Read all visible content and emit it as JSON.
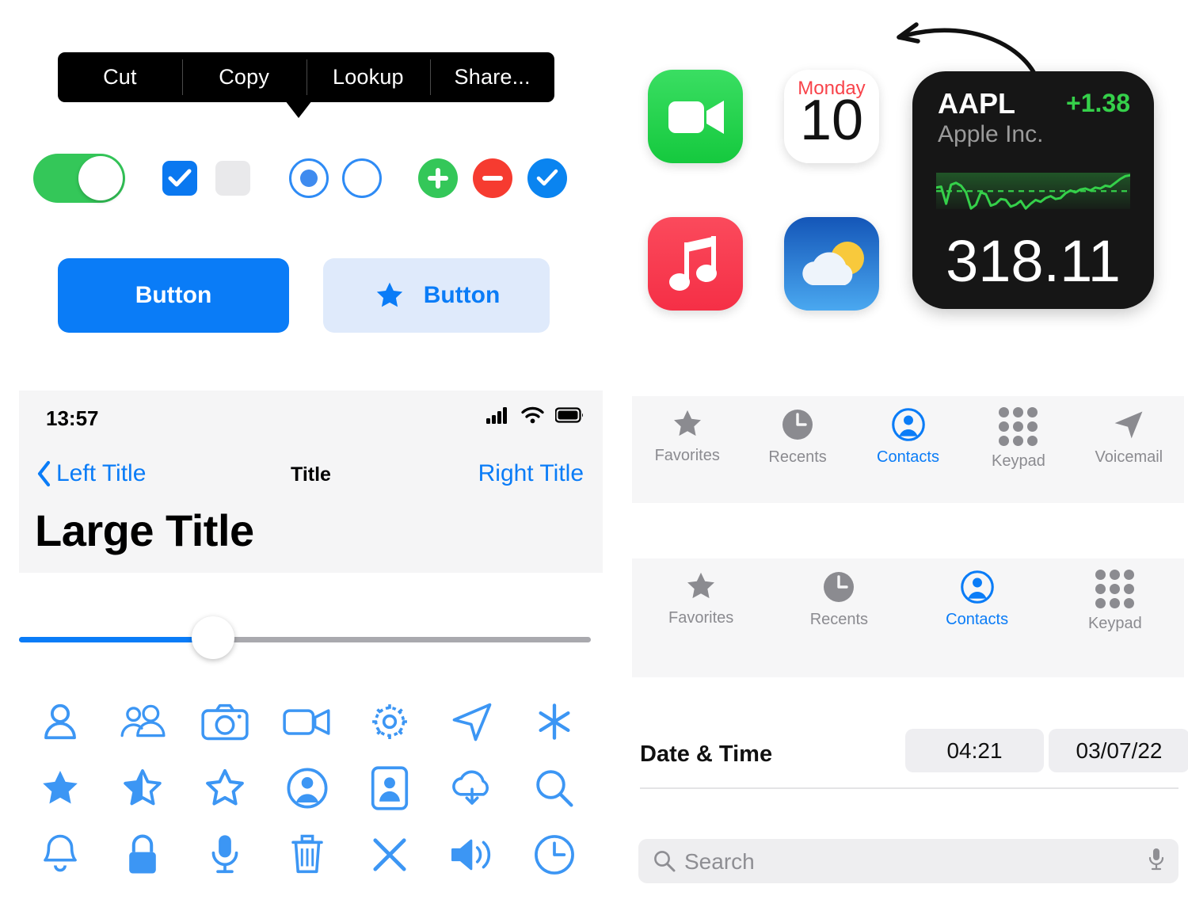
{
  "edit_menu": {
    "items": [
      {
        "label": "Cut",
        "name": "menu-item-cut"
      },
      {
        "label": "Copy",
        "name": "menu-item-copy"
      },
      {
        "label": "Lookup",
        "name": "menu-item-lookup"
      },
      {
        "label": "Share...",
        "name": "menu-item-share"
      }
    ]
  },
  "controls": {
    "toggle": {
      "state": "on",
      "color": "#34c759"
    },
    "checkbox_checked": {
      "state": "checked",
      "color": "#0a78f0"
    },
    "checkbox_unchecked": {
      "state": "unchecked",
      "color": "#e9e9eb"
    },
    "radio_selected": {
      "state": "selected",
      "color": "#2e8bf5"
    },
    "radio_unselected": {
      "state": "unselected",
      "color": "#2e8bf5"
    },
    "add_button": {
      "color": "#34c759"
    },
    "remove_button": {
      "color": "#f63b30"
    },
    "confirm_button": {
      "color": "#0a84f0"
    }
  },
  "buttons": {
    "filled": {
      "label": "Button",
      "bg": "#0a7cf7",
      "fg": "#ffffff"
    },
    "tinted": {
      "label": "Button",
      "bg": "#dfeafb",
      "fg": "#0a7cf7"
    }
  },
  "nav_panel": {
    "status_bar": {
      "time": "13:57"
    },
    "left_title": "Left Title",
    "title": "Title",
    "right_title": "Right Title",
    "large_title": "Large Title",
    "accent": "#0a7cf7"
  },
  "slider": {
    "value_percent": 34,
    "fill_color": "#0a7cf7",
    "track_color": "#a9a9ae"
  },
  "icon_grid": {
    "tint": "#3c96f4",
    "rows": [
      [
        "person-icon",
        "two-people-icon",
        "camera-icon",
        "video-camera-icon",
        "gear-icon",
        "paperplane-icon",
        "asterisk-icon"
      ],
      [
        "star-fill-icon",
        "star-half-icon",
        "star-outline-icon",
        "person-circle-fill-icon",
        "contact-card-icon",
        "cloud-download-icon",
        "magnifier-icon"
      ],
      [
        "bell-icon",
        "lock-icon",
        "microphone-icon",
        "trash-icon",
        "xmark-icon",
        "speaker-wave-icon",
        "clock-icon"
      ]
    ]
  },
  "app_icons": {
    "facetime": {
      "name": "facetime-app-icon"
    },
    "calendar": {
      "name": "calendar-app-icon",
      "weekday": "Monday",
      "day": "10"
    },
    "music": {
      "name": "music-app-icon"
    },
    "weather": {
      "name": "weather-app-icon"
    }
  },
  "stock_widget": {
    "symbol": "AAPL",
    "company": "Apple Inc.",
    "change": "+1.38",
    "price": "318.11",
    "up_color": "#35d04a",
    "bg": "#161616"
  },
  "chart_data": {
    "type": "line",
    "title": "AAPL",
    "xlabel": "",
    "ylabel": "",
    "legend": [],
    "grid": false,
    "baseline": 316.73,
    "ylim": [
      314.5,
      319.0
    ],
    "x": [
      0,
      1,
      2,
      3,
      4,
      5,
      6,
      7,
      8,
      9,
      10,
      11,
      12,
      13,
      14,
      15,
      16,
      17,
      18,
      19,
      20,
      21,
      22,
      23,
      24,
      25,
      26,
      27,
      28,
      29,
      30,
      31,
      32,
      33,
      34,
      35,
      36,
      37,
      38,
      39
    ],
    "values": [
      317.1,
      317.2,
      315.4,
      317.4,
      317.6,
      317.3,
      316.6,
      314.9,
      315.3,
      316.6,
      316.4,
      315.2,
      315.4,
      315.9,
      315.8,
      315.1,
      315.3,
      315.7,
      314.9,
      315.4,
      315.8,
      315.6,
      316.0,
      316.2,
      315.9,
      316.0,
      316.5,
      316.8,
      316.6,
      316.9,
      317.0,
      316.8,
      317.1,
      317.0,
      317.3,
      317.2,
      317.6,
      318.0,
      318.3,
      318.4
    ]
  },
  "tabbar_five": {
    "tabs": [
      {
        "label": "Favorites",
        "icon": "star-fill-icon",
        "active": false
      },
      {
        "label": "Recents",
        "icon": "clock-fill-icon",
        "active": false
      },
      {
        "label": "Contacts",
        "icon": "person-circle-fill-icon",
        "active": true
      },
      {
        "label": "Keypad",
        "icon": "keypad-icon",
        "active": false
      },
      {
        "label": "Voicemail",
        "icon": "paperplane-fill-icon",
        "active": false
      }
    ],
    "active_color": "#0a7cf7",
    "inactive_color": "#8b8b90"
  },
  "tabbar_four": {
    "tabs": [
      {
        "label": "Favorites",
        "icon": "star-fill-icon",
        "active": false
      },
      {
        "label": "Recents",
        "icon": "clock-fill-icon",
        "active": false
      },
      {
        "label": "Contacts",
        "icon": "person-circle-fill-icon",
        "active": true
      },
      {
        "label": "Keypad",
        "icon": "keypad-icon",
        "active": false
      }
    ]
  },
  "date_time_row": {
    "label": "Date & Time",
    "time_value": "04:21",
    "date_value": "03/07/22"
  },
  "search": {
    "placeholder": "Search",
    "value": "",
    "icon": "magnifier-icon",
    "trailing_icon": "microphone-icon"
  }
}
